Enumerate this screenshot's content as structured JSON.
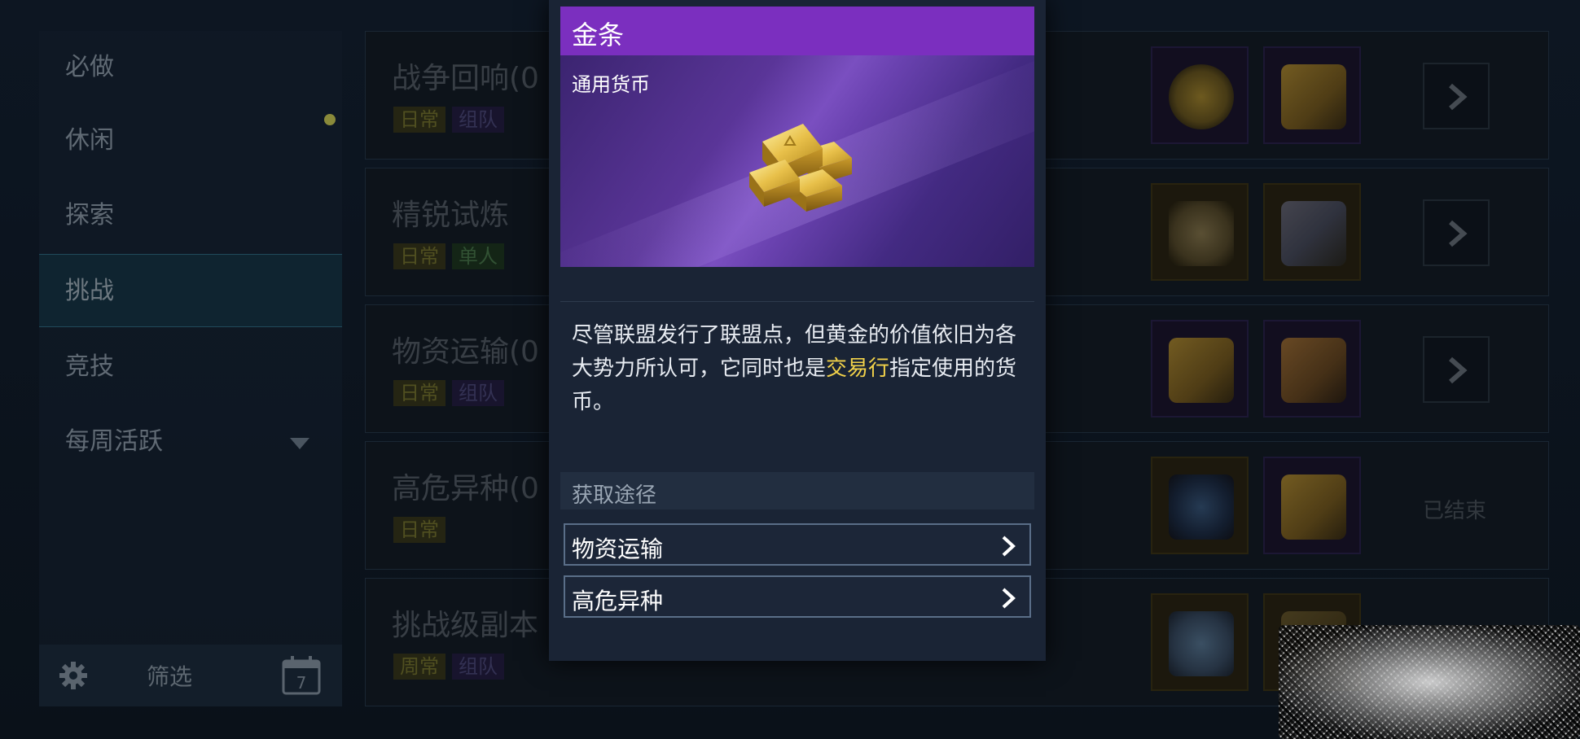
{
  "sidebar": {
    "items": [
      {
        "label": "必做"
      },
      {
        "label": "休闲"
      },
      {
        "label": "探索"
      },
      {
        "label": "挑战"
      },
      {
        "label": "竞技"
      },
      {
        "label": "每周活跃"
      }
    ],
    "active_index": 3,
    "filter_label": "筛选",
    "calendar_day": "7"
  },
  "rows": [
    {
      "title": "战争回响(0",
      "tags": [
        "日常",
        "组队"
      ],
      "action": "arrow"
    },
    {
      "title": "精锐试炼",
      "tags": [
        "日常",
        "单人"
      ],
      "action": "arrow"
    },
    {
      "title": "物资运输(0",
      "tags": [
        "日常",
        "组队"
      ],
      "action": "arrow"
    },
    {
      "title": "高危异种(0",
      "tags": [
        "日常"
      ],
      "action": "ended",
      "ended_label": "已结束"
    },
    {
      "title": "挑战级副本",
      "tags": [
        "周常",
        "组队"
      ],
      "action": "none"
    }
  ],
  "modal": {
    "title": "金条",
    "category": "通用货币",
    "description_before": "尽管联盟发行了联盟点，但黄金的价值依旧为各大势力所认可，它同时也是",
    "description_highlight": "交易行",
    "description_after": "指定使用的货币。",
    "source_title": "获取途径",
    "sources": [
      {
        "label": "物资运输"
      },
      {
        "label": "高危异种"
      }
    ]
  },
  "colors": {
    "header_purple": "#7b2fbf",
    "highlight_yellow": "#f2d24a",
    "modal_bg": "#1a2435"
  }
}
